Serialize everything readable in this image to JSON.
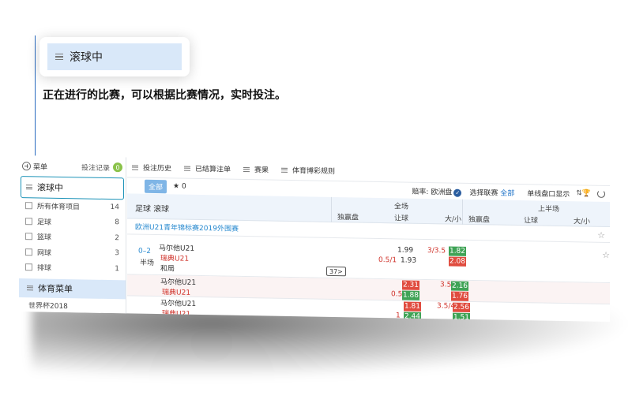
{
  "callout": {
    "title": "滚球中"
  },
  "caption": "正在进行的比赛，可以根据比赛情况，实时投注。",
  "sidebar": {
    "menu_label": "菜单",
    "records_label": "投注记录",
    "records_count": "0",
    "live_label": "滚球中",
    "sports": [
      {
        "label": "所有体育项目",
        "count": "14"
      },
      {
        "label": "足球",
        "count": "8"
      },
      {
        "label": "篮球",
        "count": "2"
      },
      {
        "label": "网球",
        "count": "3"
      },
      {
        "label": "排球",
        "count": "1"
      }
    ],
    "sports_menu": "体育菜单",
    "worldcup": "世界杯2018"
  },
  "tabs": [
    "投注历史",
    "已结算注单",
    "赛果",
    "体育博彩规则"
  ],
  "filter": {
    "all": "全部",
    "star_count": "★ 0",
    "odds_label": "赔率: 欧洲盘",
    "league_label": "选择联赛",
    "league_value": "全部",
    "single_show": "单线盘口显示"
  },
  "table_head": {
    "title": "足球 滚球",
    "full": "全场",
    "half": "上半场",
    "cols": [
      "独赢盘",
      "让球",
      "大/小",
      "独赢盘",
      "让球",
      "大/小"
    ]
  },
  "league": "欧洲U21青年锦标赛2019外围赛",
  "match": {
    "score": "0–2",
    "period": "半场",
    "home": "马尔他U21",
    "away": "瑞典U21",
    "draw": "和局",
    "more": "37>",
    "home_ml": "1.99",
    "ou_line": "3/3.5",
    "ou_over": "1.82",
    "hcp_line": "0.5/1",
    "away_hcp": "1.93",
    "ou_under": "2.08"
  },
  "row2": {
    "home": "马尔他U21",
    "away": "瑞典U21",
    "hcp_home": "2.31",
    "hcp_line": "0.5",
    "hcp_away": "1.88",
    "ou_line": "3.5",
    "ou_over": "2.16",
    "ou_under": "1.76"
  },
  "row3": {
    "home": "马尔他U21",
    "away": "瑞典U21",
    "hcp_home": "1.81",
    "hcp_away": "2.44",
    "hcp_line": "1",
    "ou_line": "3.5/4",
    "ou_over": "2.56",
    "ou_under": "1.51"
  }
}
